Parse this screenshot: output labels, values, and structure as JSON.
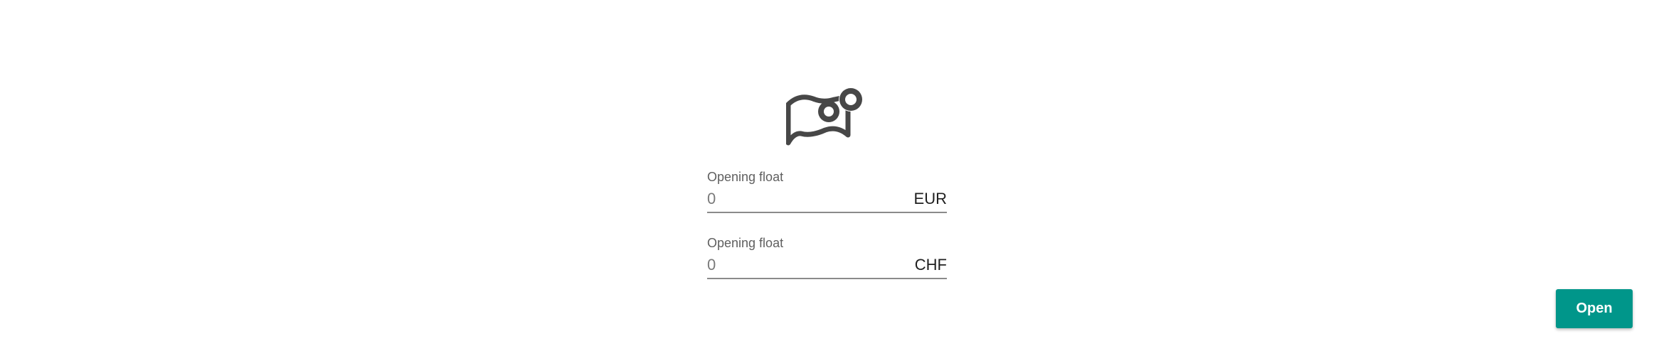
{
  "icon": {
    "name": "cash-register-open-icon",
    "color": "#474747"
  },
  "fields": [
    {
      "label": "Opening float",
      "placeholder": "0",
      "value": "",
      "currency": "EUR"
    },
    {
      "label": "Opening float",
      "placeholder": "0",
      "value": "",
      "currency": "CHF"
    }
  ],
  "actions": {
    "open_label": "Open",
    "accent_color": "#00968a"
  }
}
